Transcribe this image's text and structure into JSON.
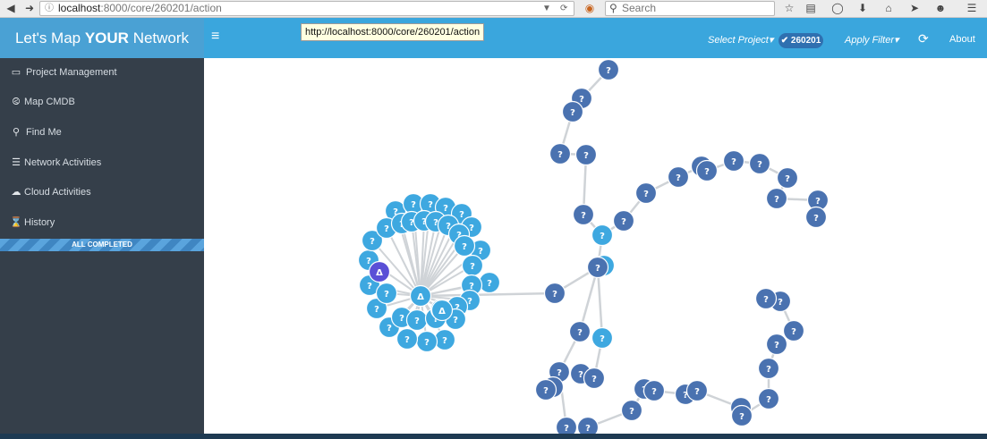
{
  "browser": {
    "url_host": "localhost",
    "url_path": ":8000/core/260201/action",
    "search_placeholder": "Search",
    "tooltip": "http://localhost:8000/core/260201/action"
  },
  "header": {
    "brand_pre": "Let's Map ",
    "brand_bold": "YOUR",
    "brand_post": " Network",
    "select_project": "Select Project",
    "project_badge": "260201",
    "apply_filter": "Apply Filter",
    "about": "About"
  },
  "sidebar": {
    "items": [
      {
        "label": "Project Management",
        "icon": "folder-icon"
      },
      {
        "label": "Map CMDB",
        "icon": "upload-icon"
      },
      {
        "label": "Find Me",
        "icon": "search-icon"
      },
      {
        "label": "Network Activities",
        "icon": "server-icon"
      },
      {
        "label": "Cloud Activities",
        "icon": "cloud-icon"
      },
      {
        "label": "History",
        "icon": "hourglass-icon"
      }
    ],
    "progress_label": "ALL COMPLETED",
    "progress_value": 1.0
  },
  "graph": {
    "node_label": "?",
    "hub_label": "Δ",
    "colors": {
      "dark": "#4a72b0",
      "light": "#3ea8e0",
      "purple": "#5a4fd6",
      "edge": "#cfd3d7"
    }
  }
}
